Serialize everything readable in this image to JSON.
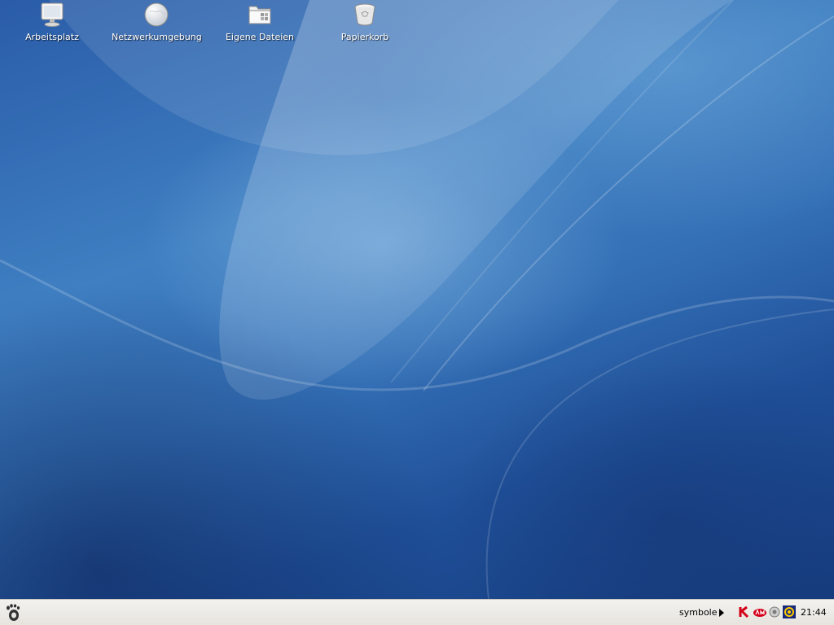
{
  "desktop": {
    "icons": [
      {
        "label": "Arbeitsplatz",
        "icon": "computer-icon"
      },
      {
        "label": "Netzwerkumgebung",
        "icon": "network-icon"
      },
      {
        "label": "Eigene Dateien",
        "icon": "folder-icon"
      },
      {
        "label": "Papierkorb",
        "icon": "trash-icon"
      }
    ]
  },
  "taskbar": {
    "menu_icon": "gnome-foot-icon",
    "symbols_label": "symbole",
    "tray_icons": [
      "kaspersky-icon",
      "am-icon",
      "speaker-icon",
      "network-status-icon"
    ],
    "clock": "21:44"
  }
}
